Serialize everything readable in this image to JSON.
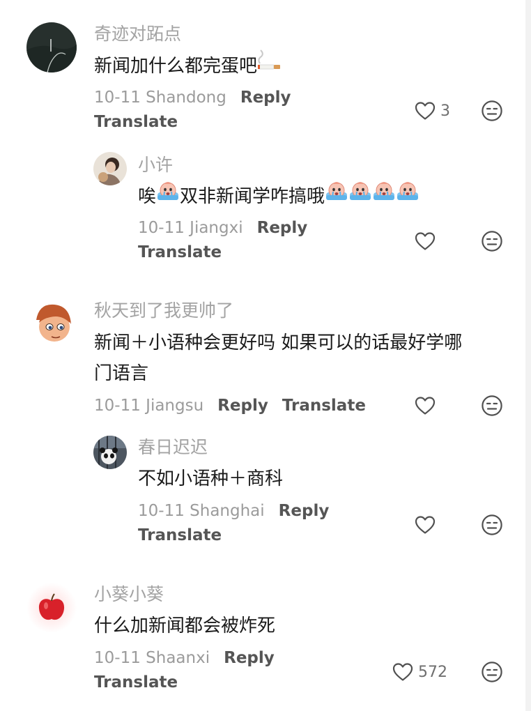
{
  "comments": [
    {
      "username": "奇迹对跖点",
      "text": "新闻加什么都完蛋吧",
      "emoji": "cigarette-emoji",
      "date": "10-11",
      "location": "Shandong",
      "reply_label": "Reply",
      "translate_label": "Translate",
      "likes": "3",
      "avatar": "dark-landscape-avatar"
    },
    {
      "username": "小许",
      "text_before": "唉",
      "text_middle": "双非新闻学咋搞哦",
      "emoji": "crying-emoji",
      "date": "10-11",
      "location": "Jiangxi",
      "reply_label": "Reply",
      "translate_label": "Translate",
      "likes": "",
      "avatar": "photo-avatar"
    },
    {
      "username": "秋天到了我更帅了",
      "text_line1": "新闻＋小语种会更好吗 如果可以的话最好学哪",
      "text_line2": "门语言",
      "date": "10-11",
      "location": "Jiangsu",
      "reply_label": "Reply",
      "translate_label": "Translate",
      "likes": "",
      "avatar": "cartoon-boy-avatar"
    },
    {
      "username": "春日迟迟",
      "text": "不如小语种＋商科",
      "date": "10-11",
      "location": "Shanghai",
      "reply_label": "Reply",
      "translate_label": "Translate",
      "likes": "",
      "avatar": "panda-photo-avatar"
    },
    {
      "username": "小葵小葵",
      "text": "什么加新闻都会被炸死",
      "date": "10-11",
      "location": "Shaanxi",
      "reply_label": "Reply",
      "translate_label": "Translate",
      "likes": "572",
      "avatar": "red-apple-avatar"
    }
  ],
  "icons": {
    "like": "heart-outline-icon",
    "dislike": "meh-face-icon"
  },
  "colors": {
    "username": "#a3a3a3",
    "text": "#1a1a1a",
    "meta": "#9b9b9b",
    "action": "#555555",
    "icon": "#505050"
  }
}
